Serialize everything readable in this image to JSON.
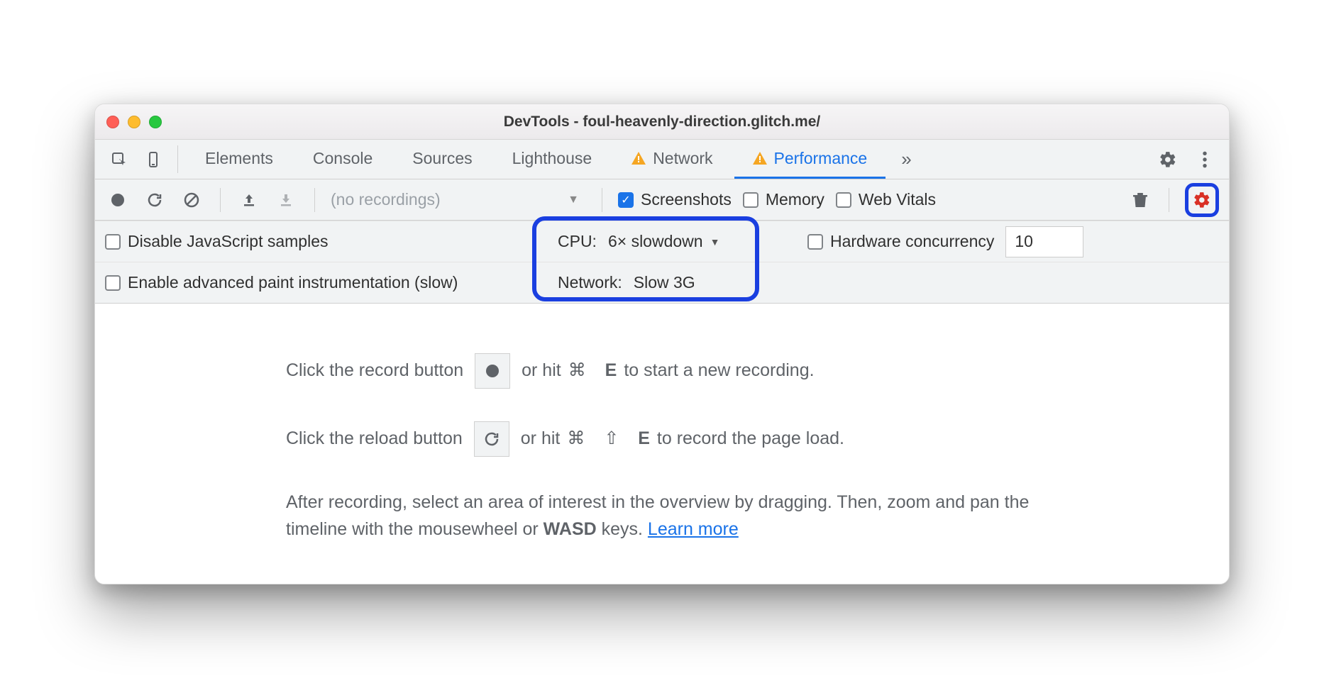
{
  "window": {
    "title": "DevTools - foul-heavenly-direction.glitch.me/"
  },
  "tabs": {
    "items": [
      {
        "label": "Elements",
        "warning": false,
        "active": false
      },
      {
        "label": "Console",
        "warning": false,
        "active": false
      },
      {
        "label": "Sources",
        "warning": false,
        "active": false
      },
      {
        "label": "Lighthouse",
        "warning": false,
        "active": false
      },
      {
        "label": "Network",
        "warning": true,
        "active": false
      },
      {
        "label": "Performance",
        "warning": true,
        "active": true
      }
    ],
    "more": "»"
  },
  "toolbar": {
    "recordings_placeholder": "(no recordings)",
    "checks": {
      "screenshots": {
        "label": "Screenshots",
        "checked": true
      },
      "memory": {
        "label": "Memory",
        "checked": false
      },
      "webvitals": {
        "label": "Web Vitals",
        "checked": false
      }
    }
  },
  "settings": {
    "disable_js": {
      "label": "Disable JavaScript samples",
      "checked": false
    },
    "paint": {
      "label": "Enable advanced paint instrumentation (slow)",
      "checked": false
    },
    "cpu": {
      "label": "CPU:",
      "value": "6× slowdown"
    },
    "network": {
      "label": "Network:",
      "value": "Slow 3G"
    },
    "hw": {
      "label": "Hardware concurrency",
      "checked": false,
      "value": "10"
    }
  },
  "main": {
    "line1a": "Click the record button ",
    "line1b": " or hit ",
    "key1": "⌘",
    "key2": "E",
    "line1c": " to start a new recording.",
    "line2a": "Click the reload button ",
    "line2b": " or hit ",
    "key3": "⌘",
    "key4": "⇧",
    "key5": "E",
    "line2c": " to record the page load.",
    "line3a": "After recording, select an area of interest in the overview by dragging. Then, zoom and pan the timeline with the mousewheel or ",
    "wasd": "WASD",
    "line3b": " keys. ",
    "learn": "Learn more"
  }
}
